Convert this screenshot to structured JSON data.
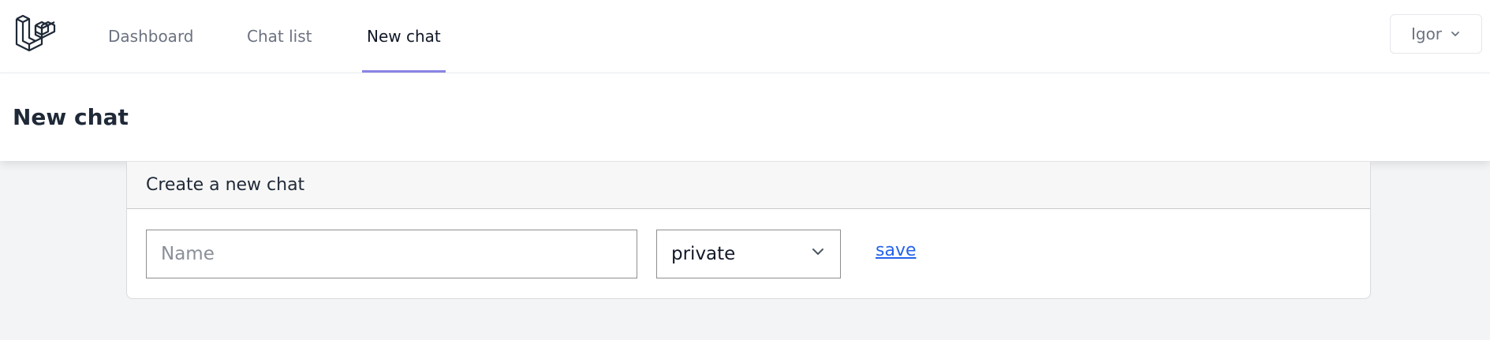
{
  "nav": {
    "logo_icon": "laravel-logo-icon",
    "links": [
      {
        "label": "Dashboard",
        "active": false
      },
      {
        "label": "Chat list",
        "active": false
      },
      {
        "label": "New chat",
        "active": true
      }
    ],
    "user": {
      "name": "Igor",
      "icon": "chevron-down-icon"
    }
  },
  "header": {
    "title": "New chat"
  },
  "card": {
    "title": "Create a new chat",
    "name_field": {
      "placeholder": "Name",
      "value": ""
    },
    "type_select": {
      "value": "private",
      "icon": "chevron-down-icon"
    },
    "save_label": "save"
  },
  "colors": {
    "active_tab_underline": "#8b85e6",
    "link": "#2563eb",
    "background": "#f3f4f6"
  }
}
